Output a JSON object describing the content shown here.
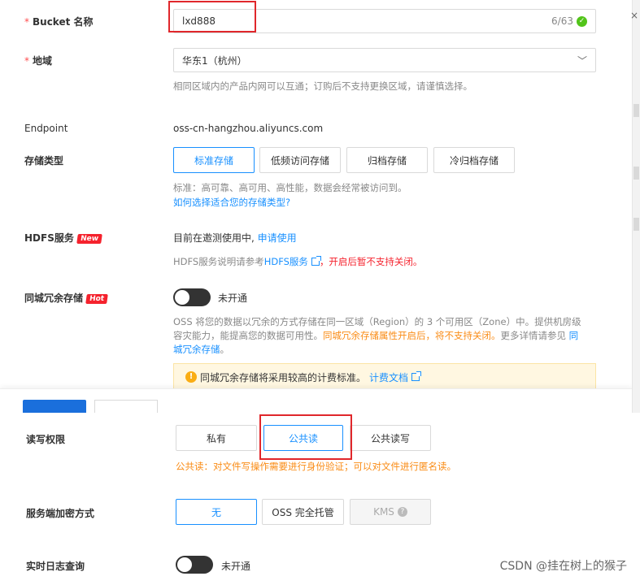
{
  "bucket": {
    "label": "Bucket 名称",
    "required": "*",
    "value": "lxd888",
    "counter": "6/63"
  },
  "region": {
    "label": "地域",
    "required": "*",
    "value": "华东1（杭州）",
    "help": "相同区域内的产品内网可以互通；订购后不支持更换区域，请谨慎选择。"
  },
  "endpoint": {
    "label": "Endpoint",
    "value": "oss-cn-hangzhou.aliyuncs.com"
  },
  "storage_class": {
    "label": "存储类型",
    "options": [
      "标准存储",
      "低频访问存储",
      "归档存储",
      "冷归档存储"
    ],
    "help": "标准：高可靠、高可用、高性能，数据会经常被访问到。",
    "link": "如何选择适合您的存储类型?"
  },
  "hdfs": {
    "label": "HDFS服务",
    "badge": "New",
    "status": "目前在邀测使用中,",
    "apply": "申请使用",
    "help_prefix": "HDFS服务说明请参考",
    "help_link": "HDFS服务",
    "help_warn": "，开启后暂不支持关闭。"
  },
  "redundancy": {
    "label": "同城冗余存储",
    "badge": "Hot",
    "toggle_text": "未开通",
    "help_line1": "OSS 将您的数据以冗余的方式存储在同一区域（Region）的 3 个可用区（Zone）中。提供机房级",
    "help_line2_a": "容灾能力，能提高您的数据可用性。",
    "help_line2_b": "同城冗余存储属性开启后，将不支持关闭。",
    "help_line2_c": "更多详情请参见",
    "help_line2_link": "同",
    "help_line3_link": "城冗余存储",
    "help_line3_end": "。",
    "notice": "同城冗余存储将采用较高的计费标准。",
    "notice_link": "计费文档"
  },
  "acl": {
    "label": "读写权限",
    "options": [
      "私有",
      "公共读",
      "公共读写"
    ],
    "note": "公共读：对文件写操作需要进行身份验证；可以对文件进行匿名读。"
  },
  "encryption": {
    "label": "服务端加密方式",
    "options": [
      "无",
      "OSS 完全托管",
      "KMS"
    ]
  },
  "logging": {
    "label": "实时日志查询",
    "toggle_text": "未开通"
  },
  "watermark": "CSDN @挂在树上的猴子",
  "colors": {
    "primary": "#1890ff",
    "highlight": "#e0272b",
    "badge": "#f5222d",
    "warning": "#fa8c16"
  }
}
